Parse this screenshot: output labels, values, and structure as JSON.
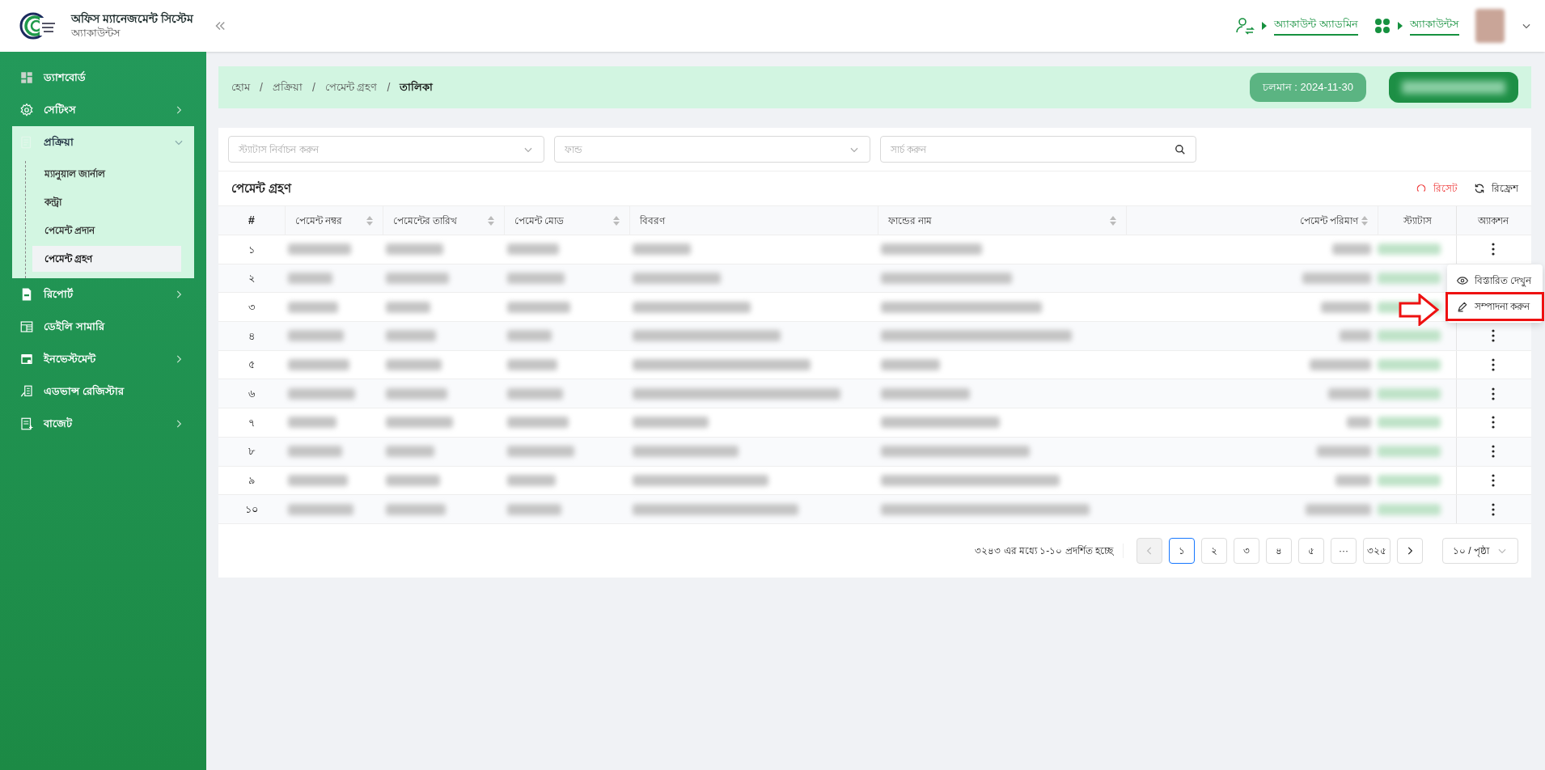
{
  "header": {
    "app_title": "অফিস ম্যানেজমেন্ট সিস্টেম",
    "app_subtitle": "অ্যাকাউন্টস",
    "links": [
      {
        "kind": "user-switch",
        "label": "অ্যাকাউন্ট অ্যাডমিন"
      },
      {
        "kind": "apps",
        "label": "অ্যাকাউন্টস"
      }
    ]
  },
  "sidebar": {
    "items": [
      {
        "kind": "dashboard",
        "label": "ড্যাশবোর্ড",
        "has_submenu": false,
        "expanded": false
      },
      {
        "kind": "gear",
        "label": "সেটিংস",
        "has_submenu": true,
        "expanded": false
      },
      {
        "kind": "notepad",
        "label": "প্রক্রিয়া",
        "has_submenu": true,
        "expanded": true,
        "children": [
          {
            "label": "ম্যানুয়াল জার্নাল",
            "selected": false
          },
          {
            "label": "কন্ট্রা",
            "selected": false
          },
          {
            "label": "পেমেন্ট প্রদান",
            "selected": false
          },
          {
            "label": "পেমেন্ট গ্রহণ",
            "selected": true
          }
        ]
      },
      {
        "kind": "document",
        "label": "রিপোর্ট",
        "has_submenu": true,
        "expanded": false
      },
      {
        "kind": "sheet",
        "label": "ডেইলি সামারি",
        "has_submenu": false,
        "expanded": false
      },
      {
        "kind": "calendar",
        "label": "ইনভেস্টমেন্ট",
        "has_submenu": true,
        "expanded": false
      },
      {
        "kind": "register",
        "label": "এডভান্স রেজিস্টার",
        "has_submenu": false,
        "expanded": false
      },
      {
        "kind": "budget",
        "label": "বাজেট",
        "has_submenu": true,
        "expanded": false
      }
    ]
  },
  "breadcrumb": {
    "separator": "/",
    "items": [
      "হোম",
      "প্রক্রিয়া",
      "পেমেন্ট গ্রহণ",
      "তালিকা"
    ]
  },
  "session_badge": "চলমান : 2024-11-30",
  "filters": [
    {
      "kind": "select",
      "placeholder": "স্ট্যাটাস নির্বাচন করুন"
    },
    {
      "kind": "select",
      "placeholder": "ফান্ড"
    },
    {
      "kind": "search",
      "placeholder": "সার্চ করুন"
    }
  ],
  "table": {
    "title": "পেমেন্ট গ্রহণ",
    "actions": [
      {
        "kind": "reset",
        "label": "রিসেট"
      },
      {
        "kind": "refresh",
        "label": "রিফ্রেশ"
      }
    ],
    "columns": [
      {
        "label": "#",
        "sortable": false
      },
      {
        "label": "পেমেন্ট নম্বর",
        "sortable": true
      },
      {
        "label": "পেমেন্টের তারিখ",
        "sortable": true
      },
      {
        "label": "পেমেন্ট মোড",
        "sortable": true
      },
      {
        "label": "বিবরণ",
        "sortable": false
      },
      {
        "label": "ফান্ডের নাম",
        "sortable": true
      },
      {
        "label": "পেমেন্ট পরিমাণ",
        "sortable": true
      },
      {
        "label": "স্ট্যাটাস",
        "sortable": false
      },
      {
        "label": "অ্যাকশন",
        "sortable": false
      }
    ],
    "rows": [
      {
        "serial": "১",
        "menu_open": false
      },
      {
        "serial": "২",
        "menu_open": true
      },
      {
        "serial": "৩",
        "menu_open": false
      },
      {
        "serial": "৪",
        "menu_open": false
      },
      {
        "serial": "৫",
        "menu_open": false
      },
      {
        "serial": "৬",
        "menu_open": false
      },
      {
        "serial": "৭",
        "menu_open": false
      },
      {
        "serial": "৮",
        "menu_open": false
      },
      {
        "serial": "৯",
        "menu_open": false
      },
      {
        "serial": "১০",
        "menu_open": false
      }
    ]
  },
  "action_menu": {
    "items": [
      {
        "kind": "view",
        "label": "বিস্তারিত দেখুন",
        "highlighted": false
      },
      {
        "kind": "edit",
        "label": "সম্পাদনা করুন",
        "highlighted": true
      }
    ]
  },
  "pagination": {
    "summary": "৩২৪৩ এর মধ্যে ১-১০ প্রদর্শিত হচ্ছে",
    "prev_disabled": true,
    "next_disabled": false,
    "pages": [
      {
        "label": "১",
        "selected": true
      },
      {
        "label": "২",
        "selected": false
      },
      {
        "label": "৩",
        "selected": false
      },
      {
        "label": "৪",
        "selected": false
      },
      {
        "label": "৫",
        "selected": false
      },
      {
        "label": "···",
        "selected": false
      },
      {
        "label": "৩২৫",
        "selected": false
      }
    ],
    "page_size": "১০ / পৃষ্ঠা"
  }
}
